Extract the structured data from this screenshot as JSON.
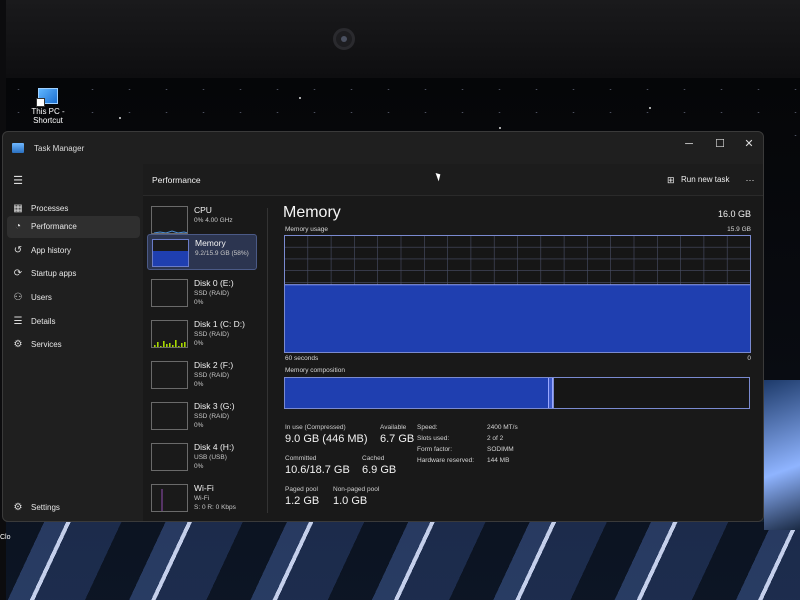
{
  "desktop": {
    "icon_label": "This PC - Shortcut",
    "side_label": "Clo"
  },
  "window": {
    "title": "Task Manager",
    "controls": {
      "minimize": "─",
      "maximize": "☐",
      "close": "✕"
    }
  },
  "sidebar": {
    "menu_icon": "hamburger-icon",
    "items": [
      {
        "label": "Processes",
        "icon": "processes-icon",
        "glyph": "▦"
      },
      {
        "label": "Performance",
        "icon": "performance-icon",
        "glyph": "◔",
        "active": true
      },
      {
        "label": "App history",
        "icon": "app-history-icon",
        "glyph": "↺"
      },
      {
        "label": "Startup apps",
        "icon": "startup-apps-icon",
        "glyph": "⟳"
      },
      {
        "label": "Users",
        "icon": "users-icon",
        "glyph": "⚇"
      },
      {
        "label": "Details",
        "icon": "details-icon",
        "glyph": "☰"
      },
      {
        "label": "Services",
        "icon": "services-icon",
        "glyph": "⚙"
      }
    ],
    "settings": {
      "label": "Settings",
      "icon": "settings-icon",
      "glyph": "⚙"
    }
  },
  "header": {
    "title": "Performance",
    "run_new_task": "Run new task",
    "more": "⋯"
  },
  "devices": [
    {
      "name": "CPU",
      "sub": "0% 4.00 GHz",
      "val": "",
      "kind": "cpu",
      "fill": 0.05,
      "active": false
    },
    {
      "name": "Memory",
      "sub": "9.2/15.9 GB (58%)",
      "val": "",
      "kind": "memory",
      "fill": 0.58,
      "active": true
    },
    {
      "name": "Disk 0 (E:)",
      "sub": "SSD (RAID)",
      "val": "0%",
      "kind": "disk",
      "fill": 0,
      "active": false
    },
    {
      "name": "Disk 1 (C: D:)",
      "sub": "SSD (RAID)",
      "val": "0%",
      "kind": "disk-activity",
      "fill": 0,
      "active": false
    },
    {
      "name": "Disk 2 (F:)",
      "sub": "SSD (RAID)",
      "val": "0%",
      "kind": "disk",
      "fill": 0,
      "active": false
    },
    {
      "name": "Disk 3 (G:)",
      "sub": "SSD (RAID)",
      "val": "0%",
      "kind": "disk",
      "fill": 0,
      "active": false
    },
    {
      "name": "Disk 4 (H:)",
      "sub": "USB (USB)",
      "val": "0%",
      "kind": "disk",
      "fill": 0,
      "active": false
    },
    {
      "name": "Wi-Fi",
      "sub": "Wi-Fi",
      "val": "S: 0 R: 0 Kbps",
      "kind": "wifi",
      "fill": 0,
      "active": false
    }
  ],
  "memory": {
    "title": "Memory",
    "total": "16.0 GB",
    "usage_label": "Memory usage",
    "usage_max": "15.9 GB",
    "graph_left": "60 seconds",
    "graph_right": "0",
    "usage_fraction": 0.58,
    "composition_label": "Memory composition",
    "composition": {
      "in_use": 0.566,
      "modified": 0.01,
      "standby": 0.425
    },
    "stats": {
      "in_use_label": "In use (Compressed)",
      "in_use_value": "9.0 GB (446 MB)",
      "available_label": "Available",
      "available_value": "6.7 GB",
      "committed_label": "Committed",
      "committed_value": "10.6/18.7 GB",
      "cached_label": "Cached",
      "cached_value": "6.9 GB",
      "paged_label": "Paged pool",
      "paged_value": "1.2 GB",
      "nonpaged_label": "Non-paged pool",
      "nonpaged_value": "1.0 GB"
    },
    "specs": [
      {
        "key": "Speed:",
        "value": "2400 MT/s"
      },
      {
        "key": "Slots used:",
        "value": "2 of 2"
      },
      {
        "key": "Form factor:",
        "value": "SODIMM"
      },
      {
        "key": "Hardware reserved:",
        "value": "144 MB"
      }
    ]
  },
  "colors": {
    "accent": "#1f3fb0",
    "accent_light": "#3b58c8",
    "graph_border": "#7a8ad0",
    "grid": "#4a4f66"
  }
}
